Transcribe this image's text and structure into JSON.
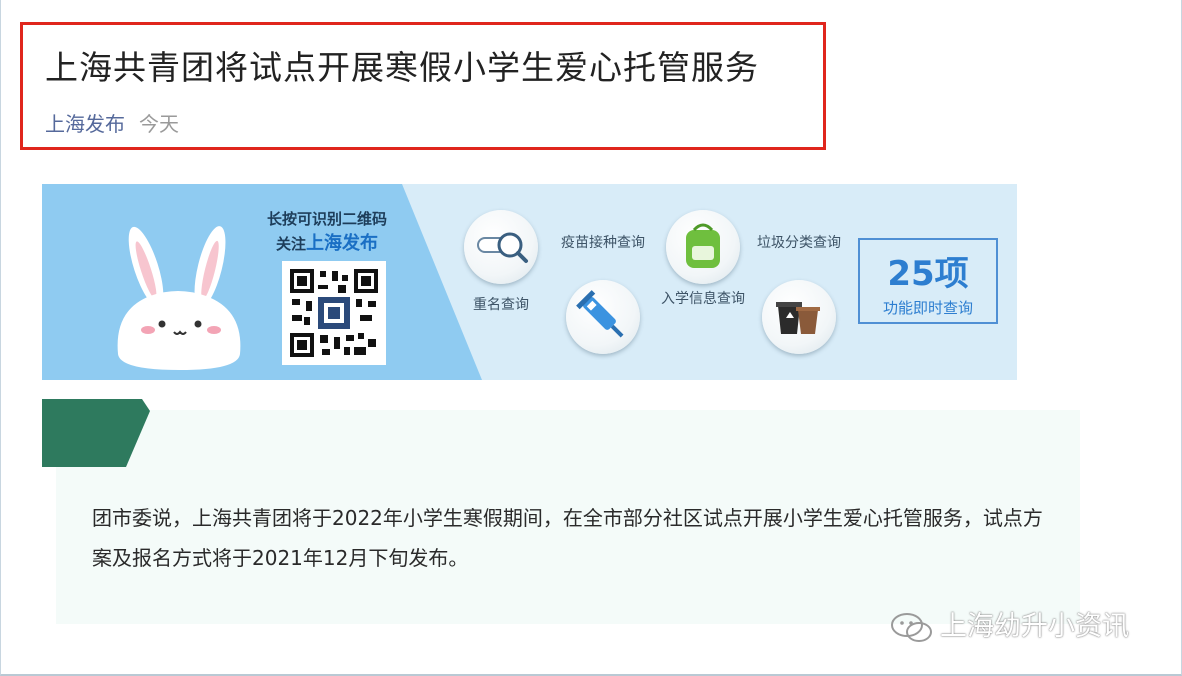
{
  "article": {
    "title": "上海共青团将试点开展寒假小学生爱心托管服务",
    "source": "上海发布",
    "time": "今天"
  },
  "banner": {
    "qr_caption_line1": "长按可识别二维码",
    "qr_caption_prefix": "关注",
    "qr_caption_highlight": "上海发布",
    "features": [
      {
        "label": "重名查询",
        "icon": "magnifier-icon"
      },
      {
        "label": "疫苗接种查询",
        "icon": "syringe-icon"
      },
      {
        "label": "入学信息查询",
        "icon": "backpack-icon"
      },
      {
        "label": "垃圾分类查询",
        "icon": "trash-bins-icon"
      }
    ],
    "count_number": "25项",
    "count_sub": "功能即时查询",
    "colors": {
      "banner_left": "#8fcbf1",
      "banner_right": "#d8ecf8",
      "accent": "#2d7ed0"
    }
  },
  "content": {
    "paragraph": "团市委说，上海共青团将于2022年小学生寒假期间，在全市部分社区试点开展小学生爱心托管服务，试点方案及报名方式将于2021年12月下旬发布。"
  },
  "watermark": {
    "text": "上海幼升小资讯"
  },
  "colors": {
    "highlight_border": "#e0261d",
    "source_link": "#55699b",
    "tab_green": "#2e7a5e"
  }
}
